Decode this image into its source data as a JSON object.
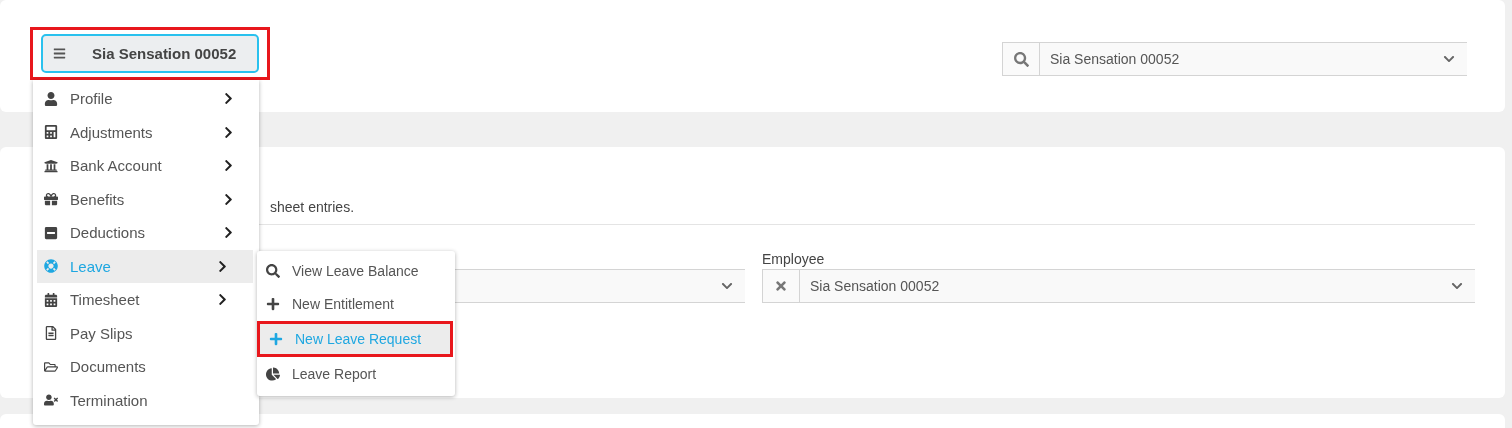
{
  "header": {
    "menu_button": {
      "label": "Sia Sensation 00052",
      "highlighted": true
    },
    "employee_search": {
      "value": "Sia Sensation 00052"
    }
  },
  "menu": {
    "items": [
      {
        "label": "Profile",
        "has_submenu": true,
        "selected": false
      },
      {
        "label": "Adjustments",
        "has_submenu": true,
        "selected": false
      },
      {
        "label": "Bank Account",
        "has_submenu": true,
        "selected": false
      },
      {
        "label": "Benefits",
        "has_submenu": true,
        "selected": false
      },
      {
        "label": "Deductions",
        "has_submenu": true,
        "selected": false
      },
      {
        "label": "Leave",
        "has_submenu": true,
        "selected": true
      },
      {
        "label": "Timesheet",
        "has_submenu": true,
        "selected": false
      },
      {
        "label": "Pay Slips",
        "has_submenu": false,
        "selected": false
      },
      {
        "label": "Documents",
        "has_submenu": false,
        "selected": false
      },
      {
        "label": "Termination",
        "has_submenu": false,
        "selected": false
      }
    ]
  },
  "submenu": {
    "items": [
      {
        "label": "View Leave Balance",
        "selected": false,
        "highlighted": false
      },
      {
        "label": "New Entitlement",
        "selected": false,
        "highlighted": false
      },
      {
        "label": "New Leave Request",
        "selected": true,
        "highlighted": true
      },
      {
        "label": "Leave Report",
        "selected": false,
        "highlighted": false
      }
    ]
  },
  "form": {
    "description": "sheet entries.",
    "fields": [
      {
        "kind": "select"
      },
      {
        "kind": "select",
        "label": "Employee",
        "value": "Sia Sensation 00052",
        "clearable": true
      }
    ]
  }
}
